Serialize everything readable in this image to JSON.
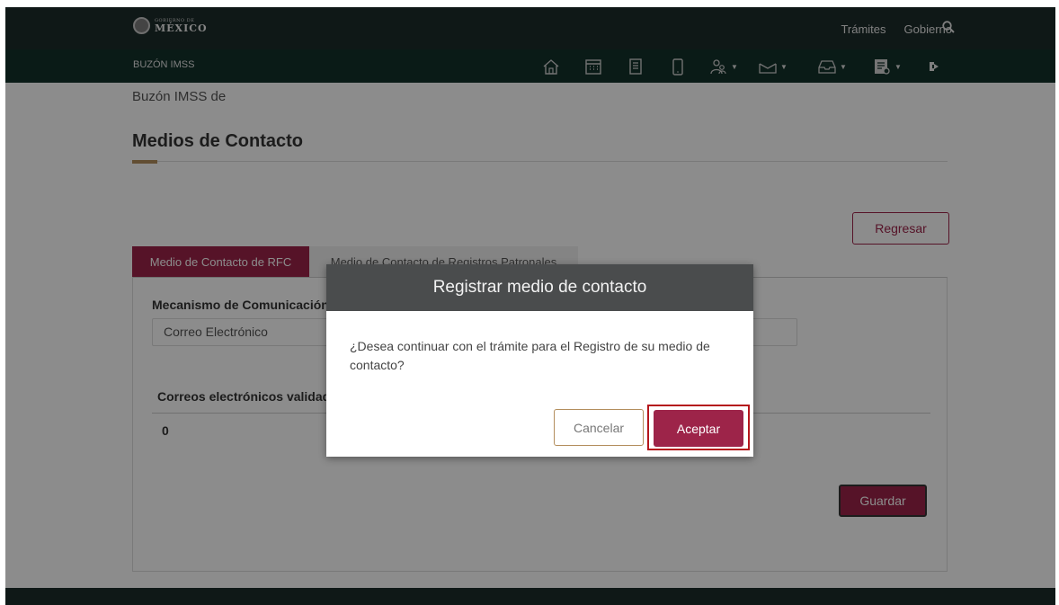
{
  "header": {
    "logo_small": "GOBIERNO DE",
    "logo_big": "MÉXICO",
    "links": [
      "Trámites",
      "Gobierno"
    ],
    "search_icon": "search-icon"
  },
  "nav": {
    "title": "BUZÓN IMSS",
    "icons": [
      "home-icon",
      "calendar-icon",
      "document-icon",
      "mobile-icon",
      "people-icon",
      "mail-icon",
      "inbox-icon",
      "report-icon",
      "logout-icon"
    ]
  },
  "page": {
    "breadcrumb": "Buzón IMSS de",
    "title": "Medios de Contacto",
    "regresar_label": "Regresar",
    "tabs": [
      {
        "label": "Medio de Contacto de RFC",
        "active": true
      },
      {
        "label": "Medio de Contacto de Registros Patronales",
        "active": false
      }
    ],
    "mechanism_label": "Mecanismo de Comunicación",
    "mechanism_value": "Correo Electrónico",
    "emails_label": "Correos electrónicos validados",
    "emails_count": "0",
    "guardar_label": "Guardar"
  },
  "modal": {
    "title": "Registrar medio de contacto",
    "body": "¿Desea continuar con el trámite para el Registro de su medio de contacto?",
    "cancel_label": "Cancelar",
    "accept_label": "Aceptar"
  },
  "colors": {
    "brand_red": "#9d2449",
    "gold": "#b38e5d",
    "top_bar": "#1d2c2a",
    "nav_bar": "#13322b",
    "highlight": "#b4161c"
  }
}
